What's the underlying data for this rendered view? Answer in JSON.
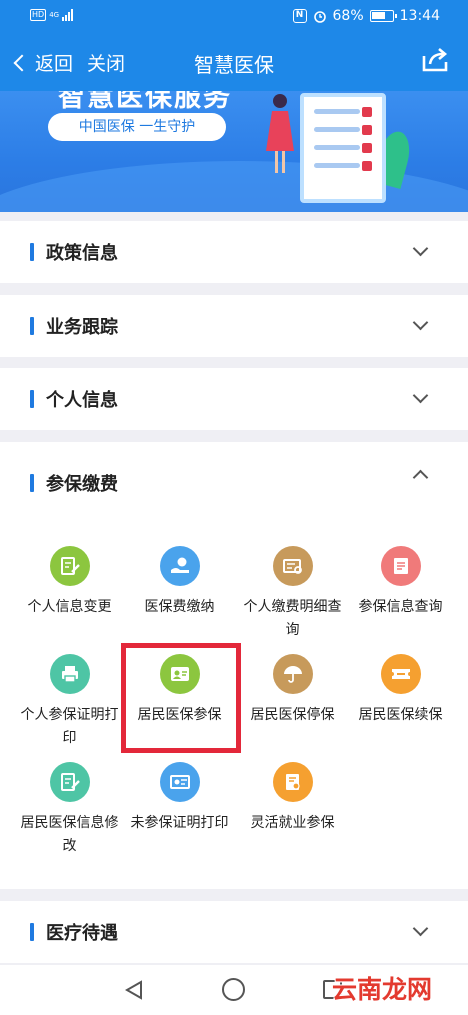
{
  "status_bar": {
    "hd": "HD",
    "network": "4G",
    "nfc": "N",
    "battery": "68%",
    "time": "13:44"
  },
  "nav": {
    "back_label": "返回",
    "close_label": "关闭",
    "title": "智慧医保"
  },
  "banner": {
    "title": "智慧医保服务",
    "slogan": "中国医保  一生守护"
  },
  "sections": [
    {
      "label": "政策信息",
      "expanded": false
    },
    {
      "label": "业务跟踪",
      "expanded": false
    },
    {
      "label": "个人信息",
      "expanded": false
    },
    {
      "label": "参保缴费",
      "expanded": true
    },
    {
      "label": "医疗待遇",
      "expanded": false
    }
  ],
  "services": [
    {
      "label": "个人信息变更",
      "icon": "edit-form-icon",
      "color": "#8cc63f"
    },
    {
      "label": "医保费缴纳",
      "icon": "hand-coin-icon",
      "color": "#4aa3ec"
    },
    {
      "label": "个人缴费明细查询",
      "icon": "search-record-icon",
      "color": "#c79a5b"
    },
    {
      "label": "参保信息查询",
      "icon": "document-icon",
      "color": "#f07a7a"
    },
    {
      "label": "个人参保证明打印",
      "icon": "printer-icon",
      "color": "#4ec5a5"
    },
    {
      "label": "居民医保参保",
      "icon": "id-card-icon",
      "color": "#8cc63f"
    },
    {
      "label": "居民医保停保",
      "icon": "umbrella-icon",
      "color": "#c79a5b"
    },
    {
      "label": "居民医保续保",
      "icon": "ticket-icon",
      "color": "#f5a030"
    },
    {
      "label": "居民医保信息修改",
      "icon": "edit-form-icon",
      "color": "#4ec5a5"
    },
    {
      "label": "未参保证明打印",
      "icon": "certificate-icon",
      "color": "#4aa3ec"
    },
    {
      "label": "灵活就业参保",
      "icon": "user-document-icon",
      "color": "#f5a030"
    }
  ],
  "watermark": "云南龙网"
}
